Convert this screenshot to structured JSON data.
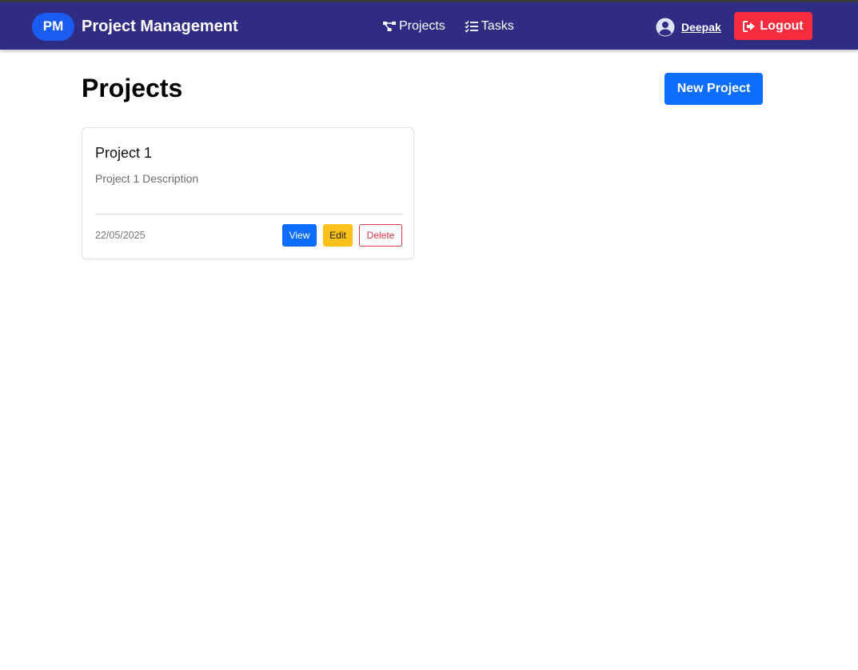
{
  "navbar": {
    "brand_badge": "PM",
    "brand_text": "Project Management",
    "links": [
      {
        "label": "Projects",
        "icon": "diagram-icon"
      },
      {
        "label": "Tasks",
        "icon": "task-list-icon"
      }
    ],
    "user": {
      "name": "Deepak",
      "icon": "user-circle-icon"
    },
    "logout_label": "Logout",
    "logout_icon": "logout-icon"
  },
  "main": {
    "title": "Projects",
    "new_project_label": "New Project",
    "projects": [
      {
        "title": "Project 1",
        "description": "Project 1 Description",
        "date": "22/05/2025",
        "actions": {
          "view": "View",
          "edit": "Edit",
          "delete": "Delete"
        }
      }
    ]
  },
  "colors": {
    "navbar_bg": "#2e2d83",
    "brand_badge_bg": "#1a5cf0",
    "logout_bg": "#f42c3d",
    "primary": "#0d6efd",
    "warning": "#fbc01a",
    "danger": "#dc3545"
  }
}
